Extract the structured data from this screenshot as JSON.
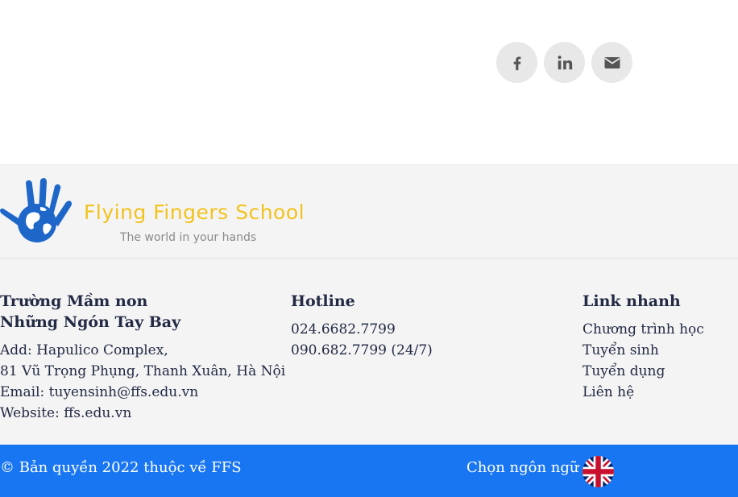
{
  "share": {
    "buttons": [
      "facebook-icon",
      "linkedin-icon",
      "email-icon"
    ]
  },
  "logo": {
    "name": "Flying Fingers School",
    "tagline": "The world in your hands"
  },
  "columns": {
    "school": {
      "title_line1": "Trường Mầm non",
      "title_line2": "Những Ngón Tay Bay",
      "address_line1": "Add: Hapulico Complex,",
      "address_line2": "81 Vũ Trọng Phụng, Thanh Xuân, Hà Nội",
      "email": "Email: tuyensinh@ffs.edu.vn",
      "website": "Website: ffs.edu.vn"
    },
    "hotline": {
      "title": "Hotline",
      "phone1": "024.6682.7799",
      "phone2": "090.682.7799 (24/7)"
    },
    "links": {
      "title": "Link nhanh",
      "items": [
        "Chương trình học",
        "Tuyển sinh",
        "Tuyển dụng",
        "Liên hệ"
      ]
    }
  },
  "bottom": {
    "copyright": "© Bản quyền 2022 thuộc về FFS",
    "language_label": "Chọn ngôn ngữ",
    "language_flag": "uk-flag-icon"
  },
  "colors": {
    "bottom_bar": "#1976f2",
    "logo_yellow": "#f2c21d",
    "logo_blue": "#1e67c9",
    "icon_bg": "#e8e8e8",
    "icon_fg": "#555555"
  }
}
